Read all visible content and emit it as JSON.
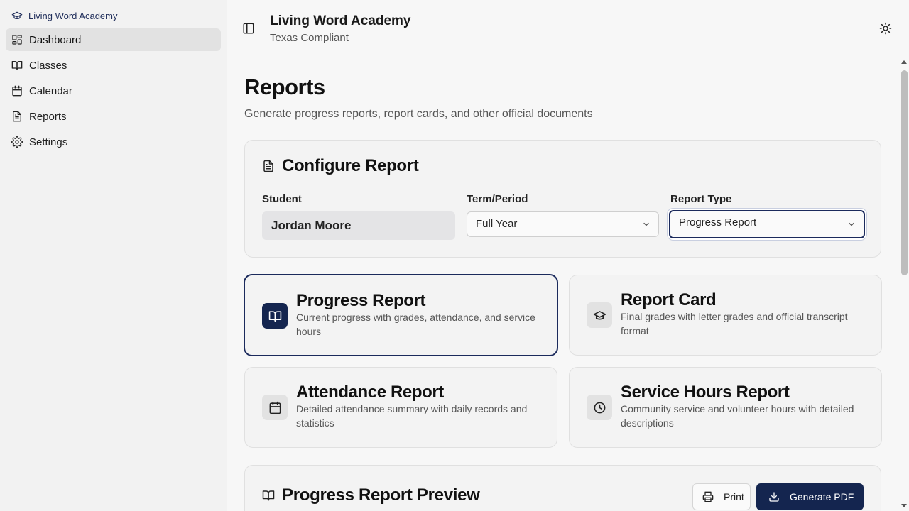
{
  "sidebar": {
    "brand": "Living Word Academy",
    "items": [
      {
        "label": "Dashboard",
        "icon": "dashboard-icon",
        "active": true
      },
      {
        "label": "Classes",
        "icon": "book-icon"
      },
      {
        "label": "Calendar",
        "icon": "calendar-icon"
      },
      {
        "label": "Reports",
        "icon": "file-icon"
      },
      {
        "label": "Settings",
        "icon": "gear-icon"
      }
    ]
  },
  "header": {
    "school_name": "Living Word Academy",
    "subtitle": "Texas Compliant"
  },
  "page": {
    "title": "Reports",
    "subtitle": "Generate progress reports, report cards, and other official documents"
  },
  "config": {
    "title": "Configure Report",
    "student_label": "Student",
    "student_value": "Jordan Moore",
    "term_label": "Term/Period",
    "term_value": "Full Year",
    "type_label": "Report Type",
    "type_value": "Progress Report"
  },
  "report_types": [
    {
      "title": "Progress Report",
      "desc": "Current progress with grades, attendance, and service hours",
      "icon": "book-open-icon",
      "selected": true
    },
    {
      "title": "Report Card",
      "desc": "Final grades with letter grades and official transcript format",
      "icon": "graduation-cap-icon"
    },
    {
      "title": "Attendance Report",
      "desc": "Detailed attendance summary with daily records and statistics",
      "icon": "calendar-icon"
    },
    {
      "title": "Service Hours Report",
      "desc": "Community service and volunteer hours with detailed descriptions",
      "icon": "clock-icon"
    }
  ],
  "preview": {
    "title": "Progress Report Preview",
    "print_label": "Print",
    "pdf_label": "Generate PDF"
  },
  "colors": {
    "accent": "#14254f",
    "background": "#f7f7f7"
  }
}
